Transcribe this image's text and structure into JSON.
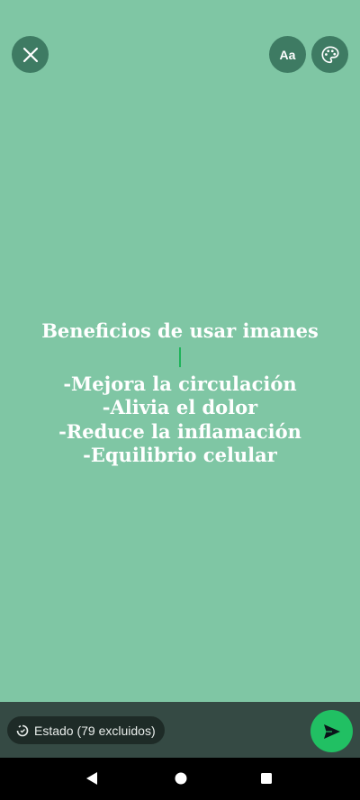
{
  "toolbar": {
    "font_label": "Aa"
  },
  "status": {
    "lines": [
      "Beneficios de usar imanes",
      "-Mejora la circulación",
      "-Alivia el dolor",
      "-Reduce la inflamación",
      "-Equilibrio celular"
    ]
  },
  "footer": {
    "audience_label": "Estado (79 excluidos)"
  },
  "colors": {
    "background": "#7fc6a4",
    "button": "#3e7b63",
    "send": "#21c063",
    "bottom_bar": "#354a44"
  },
  "icons": {
    "close": "close-icon",
    "palette": "palette-icon",
    "status_ring": "status-ring-icon",
    "send": "send-icon",
    "back": "back-triangle-icon",
    "home": "home-circle-icon",
    "recents": "recents-square-icon"
  }
}
